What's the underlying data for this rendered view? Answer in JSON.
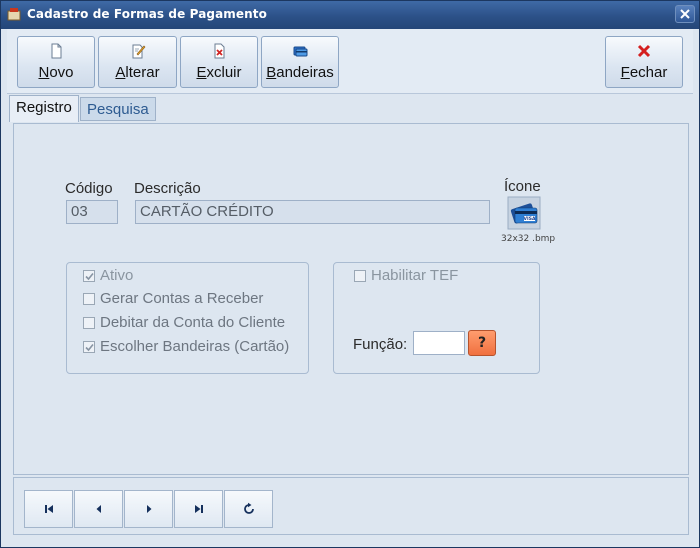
{
  "window": {
    "title": "Cadastro de Formas de Pagamento"
  },
  "toolbar": {
    "novo": {
      "accel": "N",
      "rest": "ovo"
    },
    "alterar": {
      "accel": "A",
      "rest": "lterar"
    },
    "excluir": {
      "accel": "E",
      "rest": "xcluir"
    },
    "bandeiras": {
      "accel": "B",
      "rest": "andeiras"
    },
    "fechar": {
      "accel": "F",
      "rest": "echar"
    }
  },
  "tabs": [
    {
      "label": "Registro",
      "active": true
    },
    {
      "label": "Pesquisa",
      "active": false
    }
  ],
  "form": {
    "codigo_label": "Código",
    "codigo_value": "03",
    "descricao_label": "Descrição",
    "descricao_value": "CARTÃO CRÉDITO",
    "icone_label": "Ícone",
    "icone_hint": "32x32 .bmp",
    "icone_name": "credit-card-visa-icon"
  },
  "options": [
    {
      "label": "Ativo",
      "checked": true
    },
    {
      "label": "Gerar Contas a Receber",
      "checked": false
    },
    {
      "label": "Debitar da Conta do Cliente",
      "checked": false
    },
    {
      "label": "Escolher Bandeiras (Cartão)",
      "checked": true
    }
  ],
  "tef": {
    "habilitar_label": "Habilitar TEF",
    "habilitar_checked": false,
    "funcao_label": "Função:",
    "funcao_value": "",
    "help_label": "?"
  },
  "nav": [
    "first-record-icon",
    "previous-record-icon",
    "next-record-icon",
    "last-record-icon",
    "refresh-icon"
  ],
  "colors": {
    "titlebar": "#2c5188",
    "help_button": "#f0703f",
    "background": "#dde6f0"
  }
}
